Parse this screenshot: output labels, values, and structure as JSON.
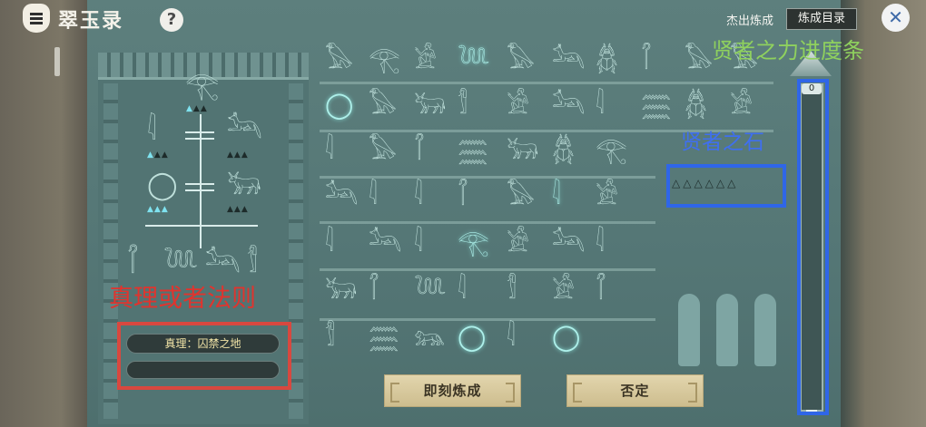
{
  "app": {
    "title": "翠玉录"
  },
  "header": {
    "help_label": "?",
    "outstanding_label": "杰出炼成",
    "catalog_label": "炼成目录",
    "close_label": "✕"
  },
  "truth": {
    "label": "真理：囚禁之地",
    "second_label": ""
  },
  "progress": {
    "value_label": "0",
    "fraction": 0.0
  },
  "actions": {
    "forge_label": "即刻炼成",
    "deny_label": "否定"
  },
  "sage_stones": {
    "display": "△△△△△△"
  },
  "annotations": {
    "truth_or_law": "真理或者法则",
    "sage_stone": "贤者之石",
    "sage_power_bar": "贤者之力进度条"
  },
  "colors": {
    "annotation_red": "#e0342e",
    "annotation_blue": "#3f6ff0",
    "annotation_green": "#8fd15e",
    "button_gold": "#d8c99c",
    "slate_teal": "#557776"
  },
  "icons": {
    "eye": "𓂀",
    "bird": "𓅃",
    "snake": "𓆙",
    "ankh": "𓋹",
    "jackal": "𓃢",
    "beetle": "𓆣",
    "lion": "𓃬",
    "bull": "𓃒",
    "reed": "𓇋",
    "mummy": "𓀾",
    "sitting_man": "𓀀",
    "ring": "◯",
    "scepter": "𓋾",
    "water": "𓈗"
  }
}
